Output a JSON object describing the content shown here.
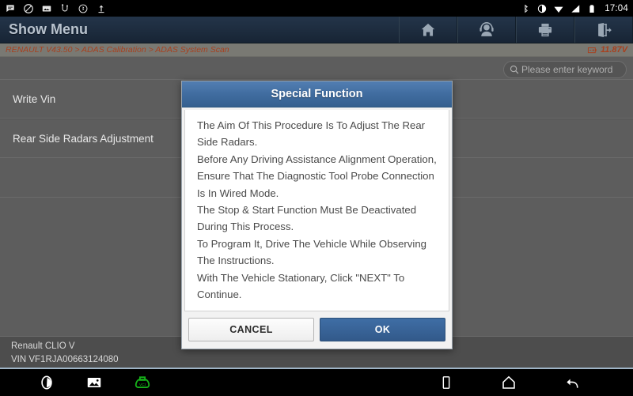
{
  "statusbar": {
    "left_icons": [
      "chat-bubble-icon",
      "do-not-disturb-icon",
      "screenshot-icon",
      "usb-icon",
      "bluetooth-pairing-icon",
      "upload-icon"
    ],
    "right_icons": [
      "bluetooth-icon",
      "brightness-icon",
      "wifi-icon",
      "signal-icon",
      "battery-icon"
    ],
    "time": "17:04"
  },
  "header": {
    "title": "Show Menu",
    "toolbar": [
      {
        "name": "home-icon",
        "label": "Home"
      },
      {
        "name": "support-icon",
        "label": "Support"
      },
      {
        "name": "print-icon",
        "label": "Print"
      },
      {
        "name": "exit-icon",
        "label": "Exit"
      }
    ]
  },
  "breadcrumb": {
    "path": "RENAULT V43.50 > ADAS Calibration > ADAS System Scan",
    "voltage": "11.87V",
    "voltage_icon": "battery-voltage-icon",
    "accent_color": "#a8411f"
  },
  "search": {
    "icon": "search-icon",
    "placeholder": "Please enter keyword",
    "value": ""
  },
  "menu": {
    "items": [
      {
        "label": "Write Vin"
      },
      {
        "label": "Rear Side Radars Adjustment"
      }
    ]
  },
  "dialog": {
    "title": "Special Function",
    "lines": [
      "The Aim Of This Procedure Is To Adjust The Rear Side Radars.",
      "Before Any Driving Assistance Alignment Operation, Ensure That The Diagnostic Tool Probe Connection Is In Wired Mode.",
      "The Stop & Start Function Must Be Deactivated During This Process.",
      "To Program It, Drive The Vehicle While Observing The Instructions.",
      "With The Vehicle Stationary, Click \"NEXT\" To Continue."
    ],
    "cancel_label": "CANCEL",
    "ok_label": "OK",
    "title_color": "#3f6b9e",
    "ok_color": "#35608f"
  },
  "vehicle": {
    "model": "Renault CLIO V",
    "vin": "VIN VF1RJA00663124080"
  },
  "navbar": {
    "left_icons": [
      "assistant-icon",
      "gallery-icon",
      "vci-connector-icon"
    ],
    "right_icons": [
      "recents-icon",
      "home-icon",
      "back-icon"
    ],
    "vci_color": "#16b11a"
  }
}
